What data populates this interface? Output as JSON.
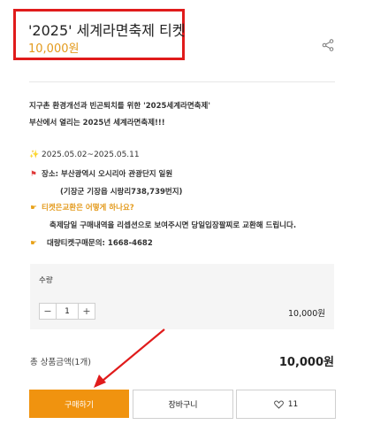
{
  "product": {
    "title": "'2025' 세계라면축제 티켓",
    "price": "10,000원"
  },
  "description": {
    "line1": "지구촌 환경개선과 빈곤퇴치를 위한 '2025세계라면축제'",
    "line2": "부산에서 열리는 2025년 세계라면축제!!!",
    "date_icon": "sparkles-icon",
    "date": "2025.05.02~2025.05.11",
    "place_icon": "flag-icon",
    "place": "장소:  부산광역시 오시리아 관광단지 일원",
    "place_detail": "(기장군 기장읍 시랑리738,739번지)",
    "exchange_icon": "pointing-hand-icon",
    "exchange_question": "티켓은교환은 어떻게 하나요?",
    "exchange_answer": "축제당일 구매내역을 리셉션으로 보여주시면  당일입장팔찌로 교환해 드립니다.",
    "inquiry_icon": "pointing-hand-icon",
    "inquiry": "대량티켓구매문의: 1668-4682"
  },
  "options": {
    "label": "수량",
    "minus": "−",
    "quantity": "1",
    "plus": "+",
    "price": "10,000원"
  },
  "total": {
    "label": "총 상품금액(1개)",
    "value": "10,000원"
  },
  "actions": {
    "buy": "구매하기",
    "cart": "장바구니",
    "like_count": "11"
  },
  "colors": {
    "accent": "#f0930f",
    "price": "#e39a1c",
    "highlight_box": "#e01b1b"
  }
}
